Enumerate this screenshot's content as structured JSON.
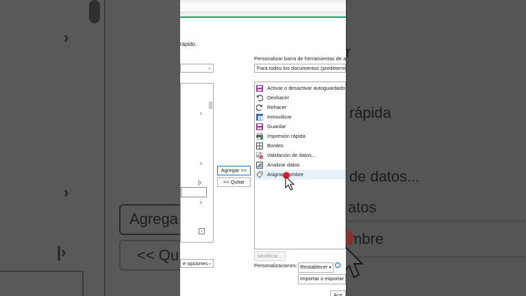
{
  "intro_text": "rápido.",
  "right_header": "Personalizar barra de herramientas de acceso",
  "right_select": "Para todos los documentos (predeterminado)",
  "items": [
    {
      "label": "Activar o desactivar autoguardado",
      "icon": "save-toggle-icon"
    },
    {
      "label": "Deshacer",
      "icon": "undo-icon"
    },
    {
      "label": "Rehacer",
      "icon": "redo-icon"
    },
    {
      "label": "Inmovilizar",
      "icon": "freeze-panes-icon"
    },
    {
      "label": "Guardar",
      "icon": "save-icon"
    },
    {
      "label": "Impresión rápida",
      "icon": "quick-print-icon"
    },
    {
      "label": "Bordes",
      "icon": "borders-icon"
    },
    {
      "label": "Validación de datos...",
      "icon": "data-validation-icon"
    },
    {
      "label": "Analizar datos",
      "icon": "analyze-data-icon"
    },
    {
      "label": "Asignar nombre",
      "icon": "define-name-icon"
    }
  ],
  "buttons": {
    "add": "Agregar >>",
    "remove": "<< Quitar",
    "modify": "Modificar...",
    "reset": "Restablecer",
    "import_export": "Importar o exportar",
    "ok_partial": "Ace"
  },
  "left_bottom_select": "e opciones",
  "customizations_label": "Personalizaciones:",
  "background": {
    "rapida": "rápida",
    "de_datos": "de datos...",
    "atos": "atos",
    "mbre": "mbre",
    "agrega": "Agrega",
    "quitar": "<< Qu"
  },
  "colors": {
    "accent": "#21a366",
    "cursor_dot": "#e81123",
    "selection": "#e5f1fb"
  }
}
